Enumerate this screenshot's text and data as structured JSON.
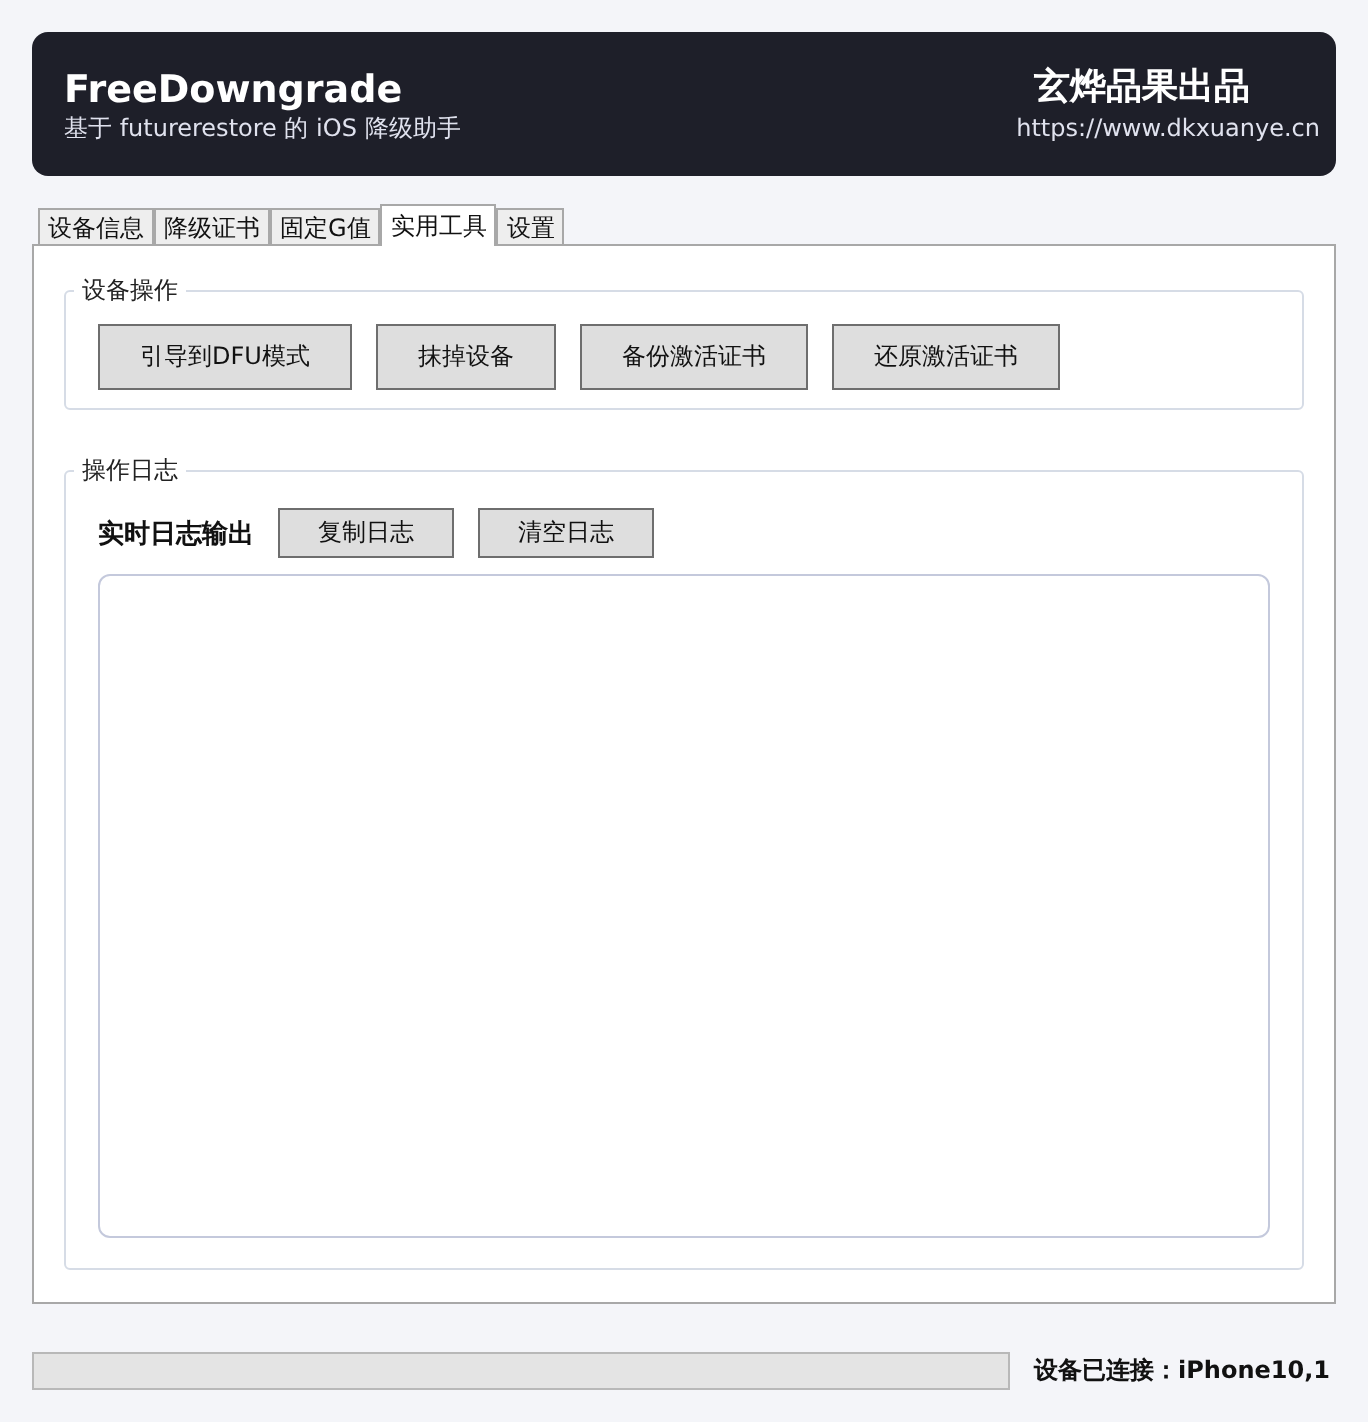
{
  "header": {
    "title": "FreeDowngrade",
    "subtitle": "基于 futurerestore 的 iOS 降级助手",
    "brand": "玄烨品果出品",
    "url": "https://www.dkxuanye.cn"
  },
  "tabs": [
    {
      "label": "设备信息",
      "selected": false
    },
    {
      "label": "降级证书",
      "selected": false
    },
    {
      "label": "固定G值",
      "selected": false
    },
    {
      "label": "实用工具",
      "selected": true
    },
    {
      "label": "设置",
      "selected": false
    }
  ],
  "device_ops": {
    "legend": "设备操作",
    "buttons": [
      "引导到DFU模式",
      "抹掉设备",
      "备份激活证书",
      "还原激活证书"
    ]
  },
  "log": {
    "legend": "操作日志",
    "label": "实时日志输出",
    "buttons": [
      "复制日志",
      "清空日志"
    ]
  },
  "status_bar": {
    "progress": {
      "level": 0
    },
    "status": "设备已连接：iPhone10,1"
  }
}
